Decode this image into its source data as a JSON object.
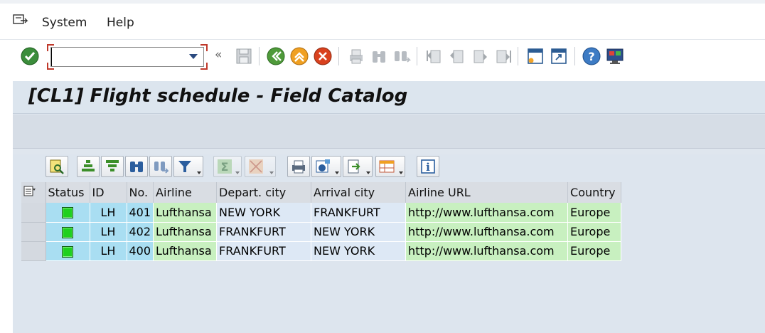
{
  "menu": {
    "items": [
      "System",
      "Help"
    ]
  },
  "toolbar": {
    "command_value": ""
  },
  "title": "[CL1]  Flight schedule - Field Catalog",
  "table": {
    "columns": [
      "Status",
      "ID",
      "No.",
      "Airline",
      "Depart. city",
      "Arrival city",
      "Airline URL",
      "Country"
    ],
    "rows": [
      {
        "status": "green",
        "id": "LH",
        "no": "401",
        "airline": "Lufthansa",
        "depart": "NEW YORK",
        "arrival": "FRANKFURT",
        "url": "http://www.lufthansa.com",
        "country": "Europe"
      },
      {
        "status": "green",
        "id": "LH",
        "no": "402",
        "airline": "Lufthansa",
        "depart": "FRANKFURT",
        "arrival": "NEW YORK",
        "url": "http://www.lufthansa.com",
        "country": "Europe"
      },
      {
        "status": "green",
        "id": "LH",
        "no": "400",
        "airline": "Lufthansa",
        "depart": "FRANKFURT",
        "arrival": "NEW YORK",
        "url": "http://www.lufthansa.com",
        "country": "Europe"
      }
    ]
  },
  "colors": {
    "key_cell": "#a9def2",
    "green_cell": "#c8f0c0",
    "blue_cell": "#dde8f5",
    "status_green": "#1fd01f"
  }
}
